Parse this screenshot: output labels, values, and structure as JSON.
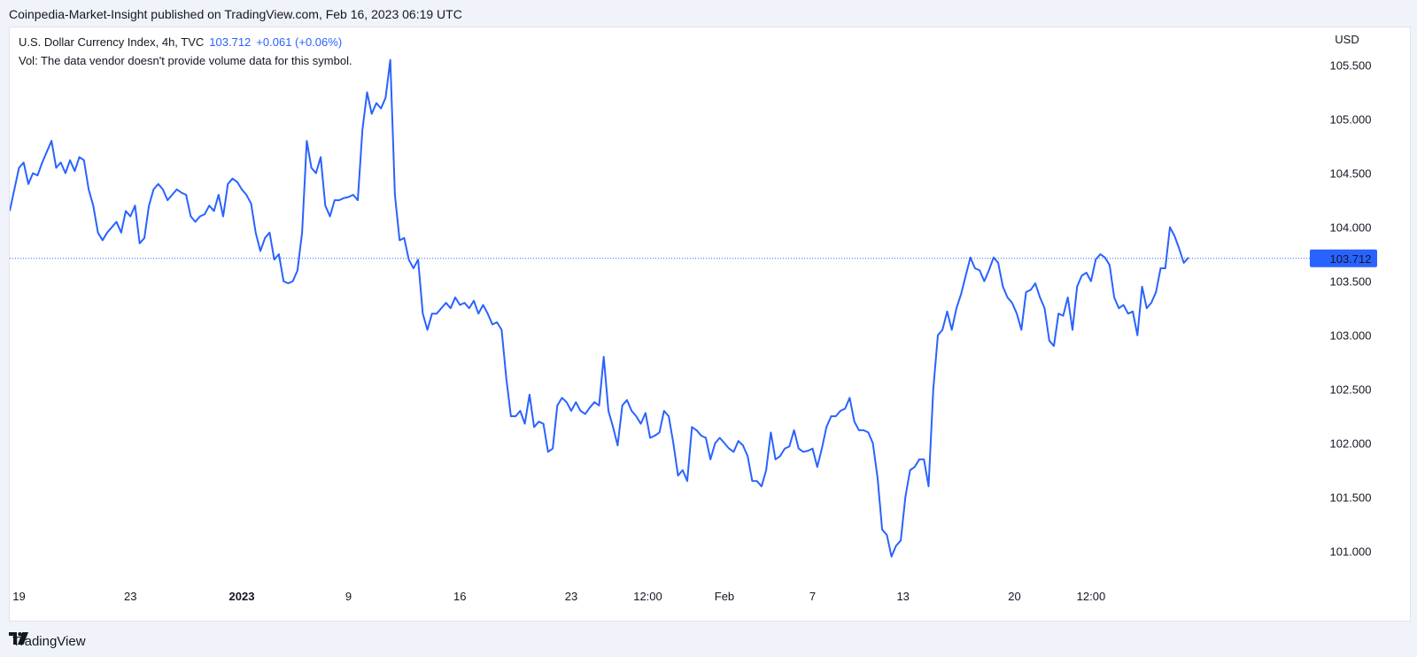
{
  "header": {
    "published": "Coinpedia-Market-Insight published on TradingView.com, Feb 16, 2023 06:19 UTC"
  },
  "legend": {
    "symbol": "U.S. Dollar Currency Index, 4h, TVC",
    "last": "103.712",
    "change": "+0.061 (+0.06%)",
    "vol_note": "Vol: The data vendor doesn't provide volume data for this symbol."
  },
  "footer": {
    "brand": "TradingView"
  },
  "colors": {
    "line": "#2962ff",
    "price_label_bg": "#2962ff",
    "text": "#131722"
  },
  "icons": {
    "logo": "tradingview-logo-icon"
  },
  "chart_data": {
    "type": "line",
    "currency": "USD",
    "y_range": [
      100.75,
      105.85
    ],
    "y_ticks": [
      "105.500",
      "105.000",
      "104.500",
      "104.000",
      "103.500",
      "103.000",
      "102.500",
      "102.000",
      "101.500",
      "101.000"
    ],
    "y_tick_values": [
      105.5,
      105.0,
      104.5,
      104.0,
      103.5,
      103.0,
      102.5,
      102.0,
      101.5,
      101.0
    ],
    "x_ticks": [
      {
        "label": "19",
        "bar": 2,
        "bold": false
      },
      {
        "label": "23",
        "bar": 26,
        "bold": false
      },
      {
        "label": "2023",
        "bar": 50,
        "bold": true
      },
      {
        "label": "9",
        "bar": 73,
        "bold": false
      },
      {
        "label": "16",
        "bar": 97,
        "bold": false
      },
      {
        "label": "23",
        "bar": 121,
        "bold": false
      },
      {
        "label": "12:00",
        "bar": 137.5,
        "bold": false
      },
      {
        "label": "Feb",
        "bar": 154,
        "bold": false
      },
      {
        "label": "7",
        "bar": 173,
        "bold": false
      },
      {
        "label": "13",
        "bar": 192.5,
        "bold": false
      },
      {
        "label": "20",
        "bar": 216.5,
        "bold": false
      },
      {
        "label": "12:00",
        "bar": 233,
        "bold": false
      }
    ],
    "last_price": 103.712,
    "last_price_label": "103.712",
    "values": [
      104.15,
      104.35,
      104.55,
      104.6,
      104.4,
      104.5,
      104.48,
      104.6,
      104.7,
      104.8,
      104.55,
      104.6,
      104.5,
      104.62,
      104.52,
      104.65,
      104.62,
      104.35,
      104.2,
      103.95,
      103.88,
      103.95,
      104.0,
      104.05,
      103.95,
      104.15,
      104.1,
      104.2,
      103.85,
      103.9,
      104.2,
      104.35,
      104.4,
      104.35,
      104.25,
      104.3,
      104.35,
      104.32,
      104.3,
      104.1,
      104.05,
      104.1,
      104.12,
      104.2,
      104.15,
      104.3,
      104.1,
      104.4,
      104.45,
      104.42,
      104.35,
      104.3,
      104.22,
      103.95,
      103.78,
      103.9,
      103.95,
      103.7,
      103.75,
      103.5,
      103.48,
      103.5,
      103.6,
      103.95,
      104.8,
      104.55,
      104.5,
      104.65,
      104.2,
      104.1,
      104.25,
      104.25,
      104.27,
      104.28,
      104.3,
      104.25,
      104.9,
      105.25,
      105.05,
      105.15,
      105.1,
      105.2,
      105.55,
      104.3,
      103.88,
      103.9,
      103.7,
      103.62,
      103.7,
      103.2,
      103.05,
      103.2,
      103.2,
      103.25,
      103.3,
      103.25,
      103.35,
      103.28,
      103.3,
      103.25,
      103.32,
      103.2,
      103.28,
      103.2,
      103.1,
      103.12,
      103.05,
      102.6,
      102.25,
      102.25,
      102.3,
      102.18,
      102.45,
      102.15,
      102.2,
      102.18,
      101.92,
      101.95,
      102.35,
      102.42,
      102.38,
      102.3,
      102.38,
      102.3,
      102.27,
      102.33,
      102.38,
      102.35,
      102.8,
      102.3,
      102.15,
      101.98,
      102.35,
      102.4,
      102.3,
      102.25,
      102.18,
      102.28,
      102.05,
      102.07,
      102.1,
      102.3,
      102.25,
      102.0,
      101.7,
      101.75,
      101.65,
      102.15,
      102.12,
      102.07,
      102.05,
      101.85,
      102.0,
      102.05,
      102.0,
      101.95,
      101.92,
      102.02,
      101.98,
      101.88,
      101.65,
      101.65,
      101.6,
      101.75,
      102.1,
      101.85,
      101.88,
      101.95,
      101.97,
      102.12,
      101.95,
      101.92,
      101.93,
      101.95,
      101.78,
      101.95,
      102.15,
      102.25,
      102.25,
      102.3,
      102.32,
      102.42,
      102.2,
      102.12,
      102.12,
      102.1,
      102.0,
      101.68,
      101.2,
      101.15,
      100.95,
      101.05,
      101.1,
      101.5,
      101.75,
      101.78,
      101.85,
      101.85,
      101.6,
      102.5,
      103.0,
      103.05,
      103.22,
      103.05,
      103.25,
      103.38,
      103.55,
      103.72,
      103.62,
      103.6,
      103.5,
      103.6,
      103.72,
      103.67,
      103.45,
      103.35,
      103.3,
      103.2,
      103.05,
      103.4,
      103.42,
      103.48,
      103.35,
      103.25,
      102.95,
      102.9,
      103.2,
      103.18,
      103.35,
      103.05,
      103.45,
      103.55,
      103.58,
      103.5,
      103.7,
      103.75,
      103.72,
      103.65,
      103.35,
      103.25,
      103.28,
      103.2,
      103.22,
      103.0,
      103.45,
      103.25,
      103.3,
      103.4,
      103.62,
      103.62,
      104.0,
      103.92,
      103.8,
      103.67,
      103.72
    ]
  }
}
